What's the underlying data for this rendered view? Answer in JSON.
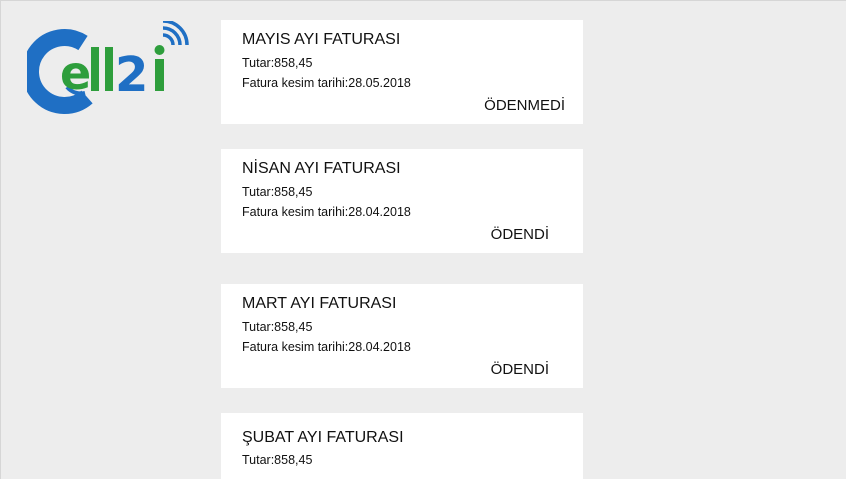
{
  "brand": {
    "logo_text": "Cell2i",
    "colors": {
      "blue": "#1f6fc4",
      "green": "#2e9e3c"
    }
  },
  "bills": [
    {
      "title": "MAYIS AYI FATURASI",
      "amount": "Tutar:858,45",
      "date": "Fatura kesim tarihi:28.05.2018",
      "status": "ÖDENMEDİ"
    },
    {
      "title": "NİSAN AYI FATURASI",
      "amount": "Tutar:858,45",
      "date": "Fatura kesim tarihi:28.04.2018",
      "status": "ÖDENDİ"
    },
    {
      "title": "MART AYI FATURASI",
      "amount": "Tutar:858,45",
      "date": "Fatura kesim tarihi:28.04.2018",
      "status": "ÖDENDİ"
    },
    {
      "title": "ŞUBAT AYI FATURASI",
      "amount": "Tutar:858,45"
    }
  ]
}
